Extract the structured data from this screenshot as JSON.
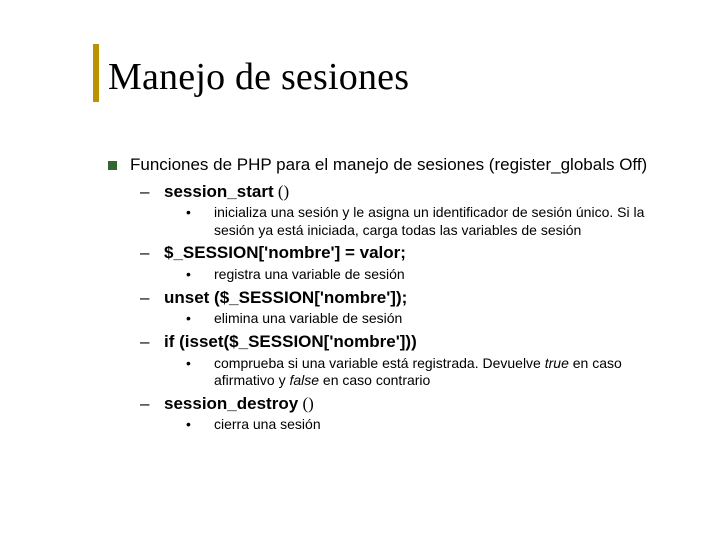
{
  "slide": {
    "title": "Manejo de sesiones",
    "p1": "Funciones de PHP para el manejo de sesiones (register_globals Off)",
    "items": [
      {
        "head": "session_start",
        "tail": " ()",
        "desc": "inicializa una sesión y le asigna un identificador de sesión único. Si la sesión ya está iniciada, carga todas las variables de sesión"
      },
      {
        "head": "$_SESSION['nombre'] = valor;",
        "tail": "",
        "desc": "registra una variable de sesión"
      },
      {
        "head": "unset ($_SESSION['nombre']);",
        "tail": "",
        "desc": "elimina una variable de sesión"
      },
      {
        "head": "if (isset($_SESSION['nombre']))",
        "tail": "",
        "desc_html": "comprueba si una variable está registrada. Devuelve <em>true</em> en caso afirmativo y <em>false</em> en caso contrario"
      },
      {
        "head": "session_destroy",
        "tail": " ()",
        "desc": "cierra una sesión"
      }
    ],
    "bullets": {
      "dash": "–",
      "dot": "•"
    }
  }
}
